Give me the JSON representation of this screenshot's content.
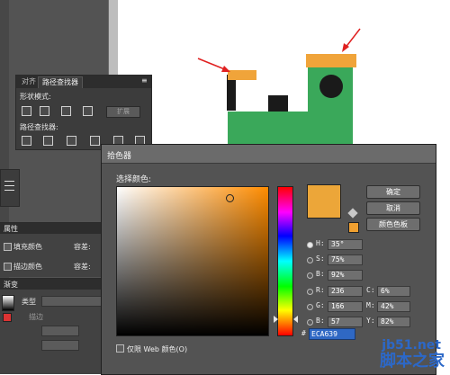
{
  "pathfinder_panel": {
    "tabs": [
      "对齐",
      "路径查找器"
    ],
    "shape_modes_label": "形状模式:",
    "expand_label": "扩展",
    "pathfinders_label": "路径查找器:"
  },
  "attributes_panel": {
    "title": "属性",
    "fill_label": "填充颜色",
    "stroke_label": "描边颜色",
    "tolerance_label": "容差:"
  },
  "gradient_panel": {
    "title": "渐变",
    "type_label": "类型",
    "stroke_label": "描边"
  },
  "color_picker": {
    "title": "拾色器",
    "select_color_label": "选择颜色:",
    "buttons": {
      "ok": "确定",
      "cancel": "取消",
      "swatches": "颜色色板"
    },
    "hsb": [
      {
        "label": "H:",
        "value": "35°"
      },
      {
        "label": "S:",
        "value": "75%"
      },
      {
        "label": "B:",
        "value": "92%"
      }
    ],
    "rgb": [
      {
        "label": "R:",
        "value": "236"
      },
      {
        "label": "G:",
        "value": "166"
      },
      {
        "label": "B:",
        "value": "57"
      }
    ],
    "cmyk": [
      {
        "label": "C:",
        "value": "6%"
      },
      {
        "label": "M:",
        "value": "42%"
      },
      {
        "label": "Y:",
        "value": "82%"
      }
    ],
    "hex_prefix": "#",
    "hex_value": "ECA639",
    "web_only_label": "仅限 Web 颜色(O)",
    "current_color": "#ECA639"
  },
  "watermark": {
    "site": "jb51.net",
    "name": "脚本之家"
  },
  "colors": {
    "train_green": "#3aa85a",
    "train_orange": "#F0A43A",
    "train_black": "#1a1a1a",
    "arrow_red": "#e02020"
  }
}
